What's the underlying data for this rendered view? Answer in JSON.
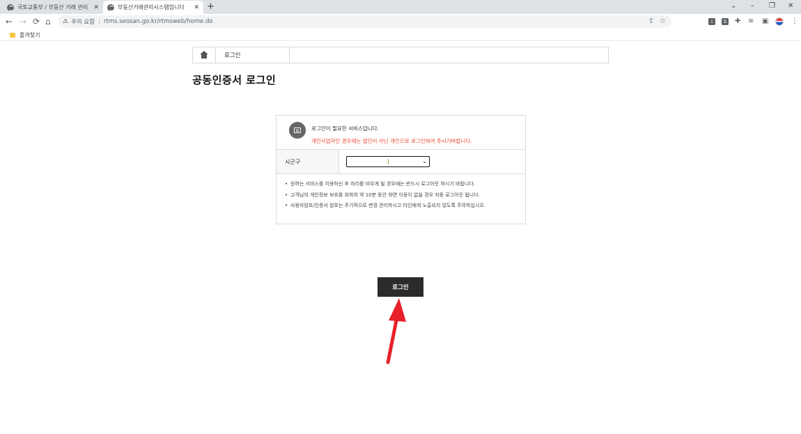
{
  "browser": {
    "tabs": [
      {
        "title": "국토교통부 / 부동산 거래 관리"
      },
      {
        "title": "부동산거래관리시스템입니다"
      }
    ],
    "new_tab_label": "+",
    "controls": {
      "collapse": "⌄",
      "minimize": "–",
      "restore": "❐",
      "close": "✕"
    },
    "nav": {
      "back": "←",
      "forward": "→",
      "reload": "⟳",
      "home": "⌂"
    },
    "address": {
      "security_warning": "주의 요함",
      "separator": "|",
      "url": "rtms.seosan.go.kr/rtmsweb/home.do"
    },
    "toolbar_icons": [
      "share-icon",
      "star-icon",
      "extension-icon",
      "puzzle-icon",
      "reading-list-icon",
      "sidebar-icon",
      "profile-avatar",
      "menu-icon"
    ],
    "bookmarks": {
      "folder_label": "즐겨찾기"
    }
  },
  "breadcrumb": {
    "home_icon": "home-icon",
    "current": "로그인"
  },
  "page": {
    "title": "공동인증서 로그인",
    "notice": {
      "line1": "로그인이 필요한 서비스입니다.",
      "line2": "개인사업자인 경우에는 법인이 아닌 개인으로 로그인하여 주시기바랍니다."
    },
    "field": {
      "label": "시군구",
      "selected_value": ""
    },
    "bullets": [
      "원하는 서비스를 이용하신 후 자리를 비우게 될 경우에는 반드시 로그아웃 하시기 바랍니다.",
      "고객님의 개인정보 보호를 위하여 약 10분 동안 화면 이동이 없을 경우 자동 로그아웃 됩니다.",
      "사용자암호/인증서 암호는 주기적으로 변경 관리하시고 타인에게 노출되지 않도록 주의하십시오."
    ],
    "login_button": "로그인"
  },
  "colors": {
    "accent_red": "#e8462d",
    "button_dark": "#2b2b2b",
    "annotation_arrow": "#e8202a"
  }
}
